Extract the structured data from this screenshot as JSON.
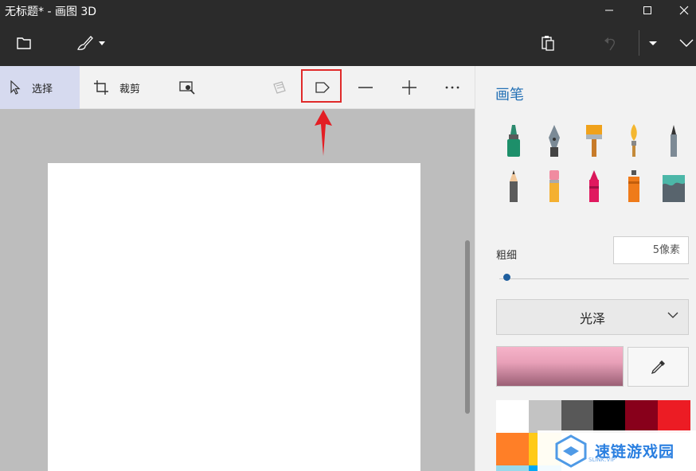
{
  "window": {
    "title": "无标题* - 画图 3D"
  },
  "toolbar": {
    "icons": [
      "folder-icon",
      "brush-menu-icon",
      "paste-icon",
      "undo-icon",
      "history-dropdown-icon",
      "expand-icon"
    ]
  },
  "ribbon": {
    "select_label": "选择",
    "crop_label": "裁剪",
    "tools": [
      "magic-select-icon",
      "3d-shapes-icon",
      "sticker-icon",
      "line-icon",
      "add-icon",
      "more-icon"
    ]
  },
  "panel": {
    "title": "画笔",
    "brushes": [
      "marker",
      "calligraphy-pen",
      "oil-brush",
      "watercolor",
      "pixel-pen",
      "pencil",
      "eraser",
      "crayon",
      "spray-can",
      "fill"
    ],
    "thickness_label": "粗细",
    "thickness_value": "5像素",
    "thickness_level": 0.02,
    "finish_label": "光泽",
    "current_color": "#f6b3c9",
    "palette": [
      "#ffffff",
      "#c3c3c3",
      "#585858",
      "#000000",
      "#88001b",
      "#ec1c24",
      "#ff7f27",
      "#ffca18",
      "#99d9ea",
      "#00a8f3"
    ]
  },
  "watermark": {
    "text": "速链游戏园",
    "sub": "SLINK.VIP"
  }
}
